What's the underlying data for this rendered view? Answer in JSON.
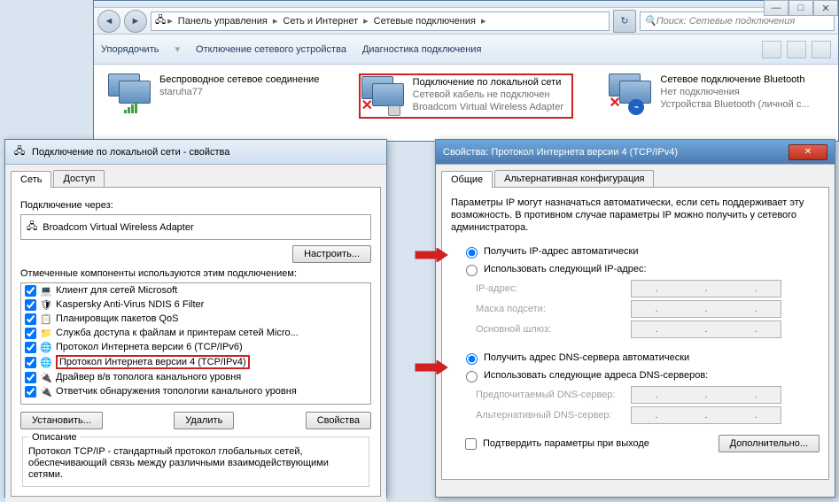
{
  "explorer": {
    "breadcrumbs": [
      "Панель управления",
      "Сеть и Интернет",
      "Сетевые подключения"
    ],
    "search_placeholder": "Поиск: Сетевые подключения",
    "toolbar": {
      "organize": "Упорядочить",
      "disable": "Отключение сетевого устройства",
      "diagnose": "Диагностика подключения"
    },
    "connections": [
      {
        "title": "Беспроводное сетевое соединение",
        "status": "",
        "device": "staruha77"
      },
      {
        "title": "Подключение по локальной сети",
        "status": "Сетевой кабель не подключен",
        "device": "Broadcom Virtual Wireless Adapter"
      },
      {
        "title": "Сетевое подключение Bluetooth",
        "status": "Нет подключения",
        "device": "Устройства Bluetooth (личной с..."
      }
    ]
  },
  "props_dialog": {
    "title": "Подключение по локальной сети - свойства",
    "tabs": {
      "net": "Сеть",
      "access": "Доступ"
    },
    "connect_via_label": "Подключение через:",
    "adapter": "Broadcom Virtual Wireless Adapter",
    "configure_btn": "Настроить...",
    "components_label": "Отмеченные компоненты используются этим подключением:",
    "components": [
      "Клиент для сетей Microsoft",
      "Kaspersky Anti-Virus NDIS 6 Filter",
      "Планировщик пакетов QoS",
      "Служба доступа к файлам и принтерам сетей Micro...",
      "Протокол Интернета версии 6 (TCP/IPv6)",
      "Протокол Интернета версии 4 (TCP/IPv4)",
      "Драйвер в/в тополога канального уровня",
      "Ответчик обнаружения топологии канального уровня"
    ],
    "install_btn": "Установить...",
    "remove_btn": "Удалить",
    "props_btn": "Свойства",
    "desc_title": "Описание",
    "desc_text": "Протокол TCP/IP - стандартный протокол глобальных сетей, обеспечивающий связь между различными взаимодействующими сетями."
  },
  "ipv4_dialog": {
    "title": "Свойства: Протокол Интернета версии 4 (TCP/IPv4)",
    "tabs": {
      "general": "Общие",
      "alt": "Альтернативная конфигурация"
    },
    "intro": "Параметры IP могут назначаться автоматически, если сеть поддерживает эту возможность. В противном случае параметры IP можно получить у сетевого администратора.",
    "ip_auto": "Получить IP-адрес автоматически",
    "ip_manual": "Использовать следующий IP-адрес:",
    "ip_label": "IP-адрес:",
    "mask_label": "Маска подсети:",
    "gateway_label": "Основной шлюз:",
    "dns_auto": "Получить адрес DNS-сервера автоматически",
    "dns_manual": "Использовать следующие адреса DNS-серверов:",
    "dns_pref": "Предпочитаемый DNS-сервер:",
    "dns_alt": "Альтернативный DNS-сервер:",
    "validate": "Подтвердить параметры при выходе",
    "advanced_btn": "Дополнительно..."
  }
}
